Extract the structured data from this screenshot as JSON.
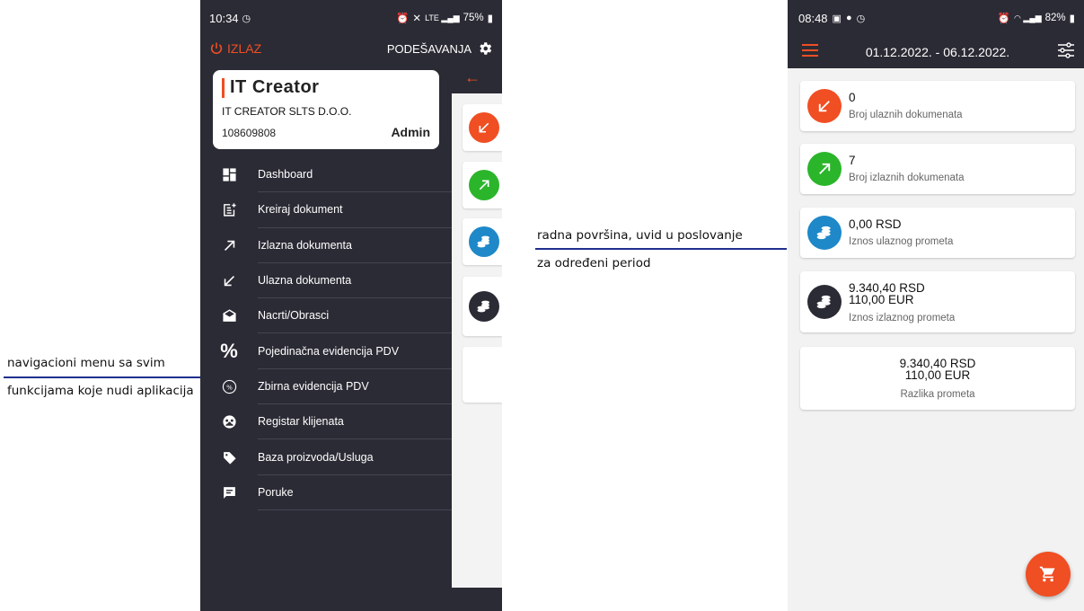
{
  "annotations": {
    "left": {
      "line1": "navigacioni menu sa svim",
      "line2": "funkcijama koje nudi aplikacija"
    },
    "middle": {
      "line1": "radna površina, uvid u poslovanje",
      "line2": "za određeni period"
    }
  },
  "left_phone": {
    "status": {
      "time": "10:34",
      "battery": "75%"
    },
    "topbar": {
      "logout_label": "IZLAZ",
      "settings_label": "PODEŠAVANJA"
    },
    "company": {
      "brand": "IT Creator",
      "name": "IT CREATOR SLTS D.O.O.",
      "id": "108609808",
      "role": "Admin"
    },
    "menu": [
      {
        "label": "Dashboard",
        "icon": "dashboard-icon"
      },
      {
        "label": "Kreiraj dokument",
        "icon": "post-add-icon"
      },
      {
        "label": "Izlazna dokumenta",
        "icon": "arrow-up-right-icon"
      },
      {
        "label": "Ulazna dokumenta",
        "icon": "arrow-down-left-icon"
      },
      {
        "label": "Nacrti/Obrasci",
        "icon": "drafts-icon"
      },
      {
        "label": "Pojedinačna evidencija PDV",
        "icon": "percent-icon"
      },
      {
        "label": "Zbirna evidencija PDV",
        "icon": "percent-circle-icon"
      },
      {
        "label": "Registar klijenata",
        "icon": "clients-icon"
      },
      {
        "label": "Baza proizvoda/Usluga",
        "icon": "tag-icon"
      },
      {
        "label": "Poruke",
        "icon": "message-icon"
      }
    ]
  },
  "right_phone": {
    "status": {
      "time": "08:48",
      "battery": "82%"
    },
    "date_range": "01.12.2022. - 06.12.2022.",
    "cards": [
      {
        "value": "0",
        "label": "Broj ulaznih dokumenata",
        "icon": "arrow-down-left-icon",
        "color": "#f04e23"
      },
      {
        "value": "7",
        "label": "Broj izlaznih dokumenata",
        "icon": "arrow-up-right-icon",
        "color": "#2bb52b"
      },
      {
        "value": "0,00 RSD",
        "label": "Iznos ulaznog prometa",
        "icon": "coins-icon",
        "color": "#1e88c8"
      },
      {
        "value": "9.340,40 RSD",
        "value2": "110,00 EUR",
        "label": "Iznos izlaznog prometa",
        "icon": "coins-icon",
        "color": "#2b2b35"
      }
    ],
    "diff_card": {
      "value": "9.340,40 RSD",
      "value2": "110,00 EUR",
      "label": "Razlika prometa"
    }
  },
  "colors": {
    "accent": "#f04e23",
    "dark": "#2b2b35",
    "green": "#2bb52b",
    "blue": "#1e88c8",
    "annotation_line": "#1f2f8f"
  }
}
